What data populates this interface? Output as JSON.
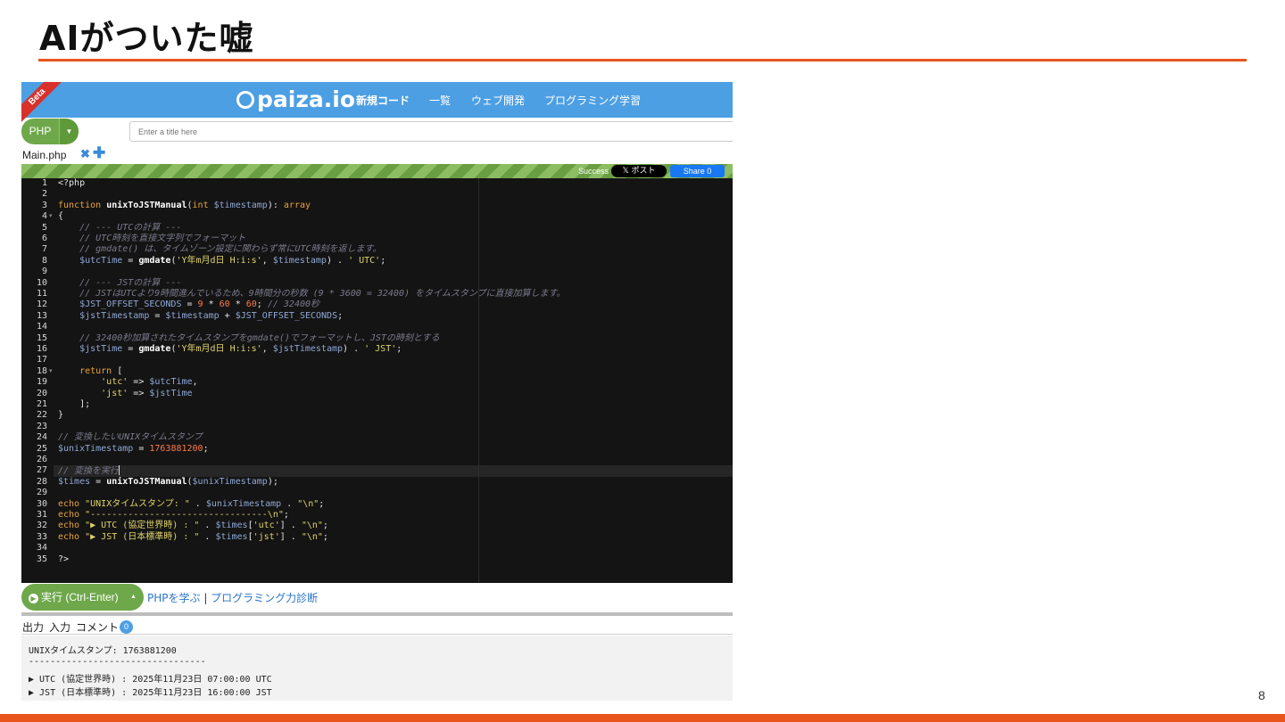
{
  "slide": {
    "title": "AIがついた嘘",
    "page_number": "8"
  },
  "colors": {
    "accent": "#e8541c",
    "header_blue": "#4d9fe3",
    "run_green": "#6ea84a"
  },
  "app": {
    "beta_label": "Beta",
    "logo_text": "paiza.io",
    "nav": [
      "新規コード",
      "一覧",
      "ウェブ開発",
      "プログラミング学習"
    ],
    "language": "PHP",
    "title_placeholder": "Enter a title here",
    "file_tab": "Main.php",
    "file_close_icon": "✖",
    "add_file_icon": "✚",
    "status": "Success",
    "post_button": "𝕏 ポスト",
    "share_button": "Share 0",
    "run_button": "実行 (Ctrl-Enter)",
    "learn_link": "PHPを学ぶ",
    "separator": " | ",
    "diagnose_link": "プログラミング力診断",
    "output_tabs": [
      "出力",
      "入力",
      "コメント"
    ],
    "comment_count": "0"
  },
  "editor": {
    "lines": [
      [
        [
          "op",
          "<?php"
        ]
      ],
      [],
      [
        [
          "kw",
          "function "
        ],
        [
          "fn",
          "unixToJSTManual"
        ],
        [
          "op",
          "("
        ],
        [
          "kw",
          "int "
        ],
        [
          "var",
          "$timestamp"
        ],
        [
          "op",
          "): "
        ],
        [
          "kw",
          "array"
        ]
      ],
      [
        [
          "op",
          "{"
        ]
      ],
      [
        [
          "cm",
          "    // --- UTCの計算 ---"
        ]
      ],
      [
        [
          "cm",
          "    // UTC時刻を直接文字列でフォーマット"
        ]
      ],
      [
        [
          "cm",
          "    // gmdate() は、タイムゾーン設定に関わらず常にUTC時刻を返します。"
        ]
      ],
      [
        [
          "var",
          "    $utcTime"
        ],
        [
          "op",
          " = "
        ],
        [
          "fn",
          "gmdate"
        ],
        [
          "op",
          "("
        ],
        [
          "str",
          "'Y年m月d日 H:i:s'"
        ],
        [
          "op",
          ", "
        ],
        [
          "var",
          "$timestamp"
        ],
        [
          "op",
          ") . "
        ],
        [
          "str",
          "' UTC'"
        ],
        [
          "op",
          ";"
        ]
      ],
      [],
      [
        [
          "cm",
          "    // --- JSTの計算 ---"
        ]
      ],
      [
        [
          "cm",
          "    // JSTはUTCより9時間進んでいるため、9時間分の秒数 (9 * 3600 = 32400) をタイムスタンプに直接加算します。"
        ]
      ],
      [
        [
          "var",
          "    $JST_OFFSET_SECONDS"
        ],
        [
          "op",
          " = "
        ],
        [
          "num",
          "9"
        ],
        [
          "op",
          " * "
        ],
        [
          "num",
          "60"
        ],
        [
          "op",
          " * "
        ],
        [
          "num",
          "60"
        ],
        [
          "op",
          "; "
        ],
        [
          "cm",
          "// 32400秒"
        ]
      ],
      [
        [
          "var",
          "    $jstTimestamp"
        ],
        [
          "op",
          " = "
        ],
        [
          "var",
          "$timestamp"
        ],
        [
          "op",
          " + "
        ],
        [
          "var",
          "$JST_OFFSET_SECONDS"
        ],
        [
          "op",
          ";"
        ]
      ],
      [],
      [
        [
          "cm",
          "    // 32400秒加算されたタイムスタンプをgmdate()でフォーマットし、JSTの時刻とする"
        ]
      ],
      [
        [
          "var",
          "    $jstTime"
        ],
        [
          "op",
          " = "
        ],
        [
          "fn",
          "gmdate"
        ],
        [
          "op",
          "("
        ],
        [
          "str",
          "'Y年m月d日 H:i:s'"
        ],
        [
          "op",
          ", "
        ],
        [
          "var",
          "$jstTimestamp"
        ],
        [
          "op",
          ") . "
        ],
        [
          "str",
          "' JST'"
        ],
        [
          "op",
          ";"
        ]
      ],
      [],
      [
        [
          "kw",
          "    return "
        ],
        [
          "op",
          "["
        ]
      ],
      [
        [
          "str",
          "        'utc'"
        ],
        [
          "op",
          " => "
        ],
        [
          "var",
          "$utcTime"
        ],
        [
          "op",
          ","
        ]
      ],
      [
        [
          "str",
          "        'jst'"
        ],
        [
          "op",
          " => "
        ],
        [
          "var",
          "$jstTime"
        ]
      ],
      [
        [
          "op",
          "    ];"
        ]
      ],
      [
        [
          "op",
          "}"
        ]
      ],
      [],
      [
        [
          "cm",
          "// 変換したいUNIXタイムスタンプ"
        ]
      ],
      [
        [
          "var",
          "$unixTimestamp"
        ],
        [
          "op",
          " = "
        ],
        [
          "num",
          "1763881200"
        ],
        [
          "op",
          ";"
        ]
      ],
      [],
      [
        [
          "cm",
          "// 変換を実行"
        ]
      ],
      [
        [
          "var",
          "$times"
        ],
        [
          "op",
          " = "
        ],
        [
          "fn",
          "unixToJSTManual"
        ],
        [
          "op",
          "("
        ],
        [
          "var",
          "$unixTimestamp"
        ],
        [
          "op",
          ");"
        ]
      ],
      [],
      [
        [
          "kw",
          "echo "
        ],
        [
          "str",
          "\"UNIXタイムスタンプ: \""
        ],
        [
          "op",
          " . "
        ],
        [
          "var",
          "$unixTimestamp"
        ],
        [
          "op",
          " . "
        ],
        [
          "str",
          "\"\\n\""
        ],
        [
          "op",
          ";"
        ]
      ],
      [
        [
          "kw",
          "echo "
        ],
        [
          "str",
          "\"---------------------------------\\n\""
        ],
        [
          "op",
          ";"
        ]
      ],
      [
        [
          "kw",
          "echo "
        ],
        [
          "str",
          "\"▶ UTC (協定世界時) : \""
        ],
        [
          "op",
          " . "
        ],
        [
          "var",
          "$times"
        ],
        [
          "op",
          "["
        ],
        [
          "str",
          "'utc'"
        ],
        [
          "op",
          "] . "
        ],
        [
          "str",
          "\"\\n\""
        ],
        [
          "op",
          ";"
        ]
      ],
      [
        [
          "kw",
          "echo "
        ],
        [
          "str",
          "\"▶ JST (日本標準時) : \""
        ],
        [
          "op",
          " . "
        ],
        [
          "var",
          "$times"
        ],
        [
          "op",
          "["
        ],
        [
          "str",
          "'jst'"
        ],
        [
          "op",
          "] . "
        ],
        [
          "str",
          "\"\\n\""
        ],
        [
          "op",
          ";"
        ]
      ],
      [],
      [
        [
          "op",
          "?>"
        ]
      ]
    ],
    "fold_lines": [
      4,
      18
    ],
    "active_line": 27
  },
  "output": {
    "lines": [
      "UNIXタイムスタンプ: 1763881200",
      "---------------------------------",
      "▶ UTC (協定世界時) : 2025年11月23日 07:00:00 UTC",
      "▶ JST (日本標準時) : 2025年11月23日 16:00:00 JST"
    ]
  }
}
